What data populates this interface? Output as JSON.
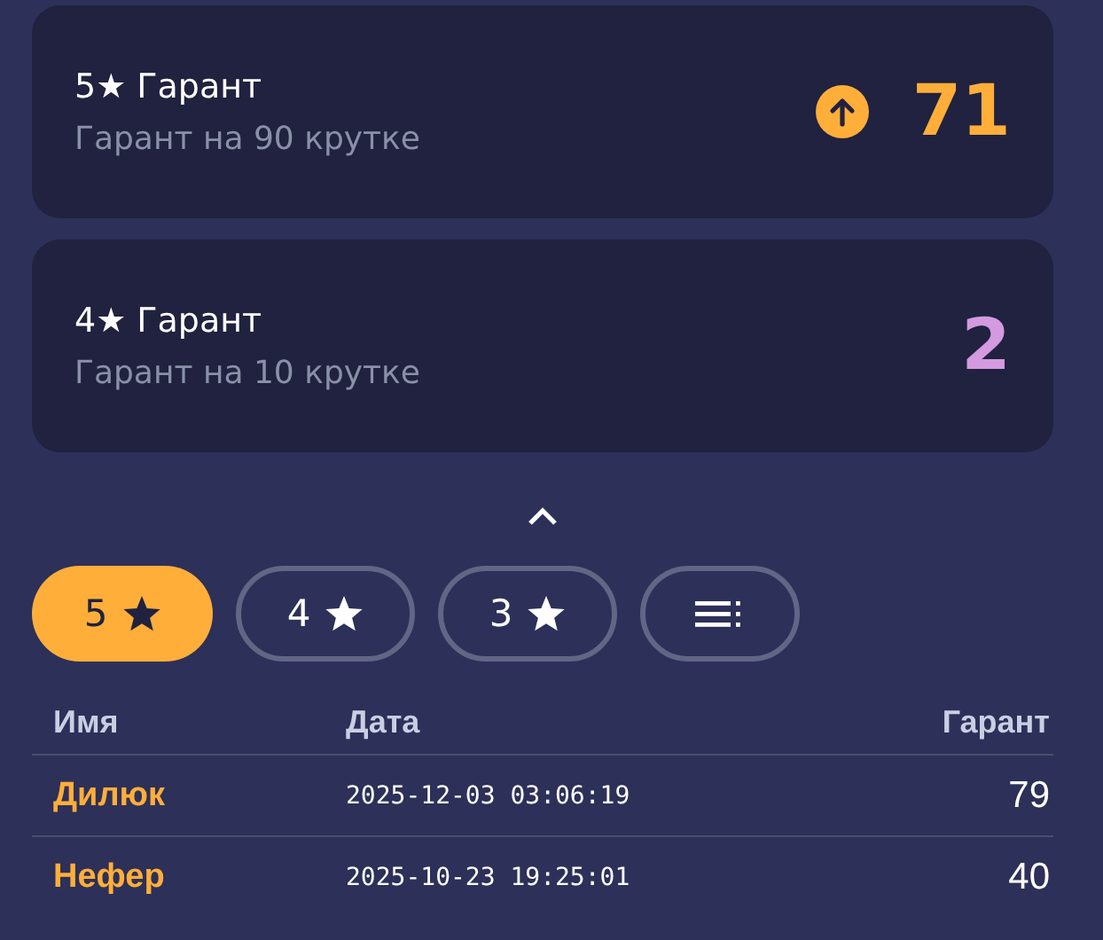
{
  "cards": [
    {
      "title": "5★ Гарант",
      "subtitle": "Гарант на 90 крутке",
      "value": "71",
      "color": "#ffae3a",
      "rising": true
    },
    {
      "title": "4★ Гарант",
      "subtitle": "Гарант на 10 крутке",
      "value": "2",
      "color": "#d39ae0",
      "rising": false
    }
  ],
  "collapse": {
    "expanded": true
  },
  "filters": [
    {
      "kind": "stars",
      "label": "5",
      "selected": true
    },
    {
      "kind": "stars",
      "label": "4",
      "selected": false
    },
    {
      "kind": "stars",
      "label": "3",
      "selected": false
    },
    {
      "kind": "list",
      "selected": false
    }
  ],
  "table": {
    "columns": [
      "Имя",
      "Дата",
      "Гарант"
    ],
    "rows": [
      {
        "name": "Дилюк",
        "date": "2025-12-03 03:06:19",
        "pity": "79",
        "color": "#ffae3a"
      },
      {
        "name": "Нефер",
        "date": "2025-10-23 19:25:01",
        "pity": "40",
        "color": "#ffae3a"
      }
    ]
  }
}
